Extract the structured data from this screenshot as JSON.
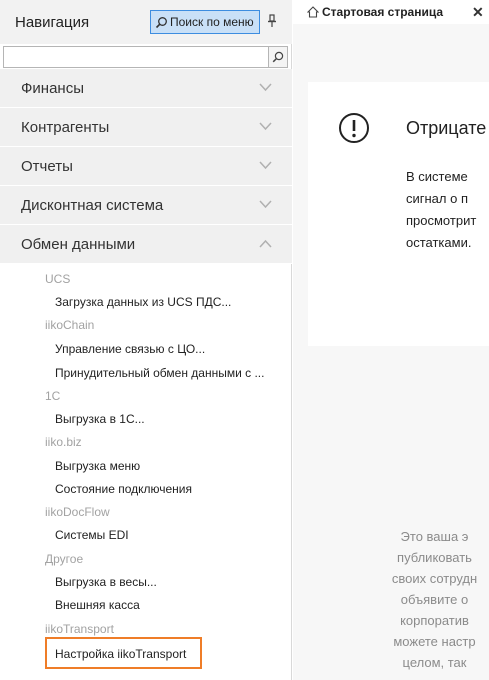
{
  "nav": {
    "title": "Навигация",
    "search_button_label": "Поиск по меню",
    "search_placeholder": "",
    "sections": [
      {
        "label": "Финансы",
        "expanded": false
      },
      {
        "label": "Контрагенты",
        "expanded": false
      },
      {
        "label": "Отчеты",
        "expanded": false
      },
      {
        "label": "Дисконтная система",
        "expanded": false
      },
      {
        "label": "Обмен данными",
        "expanded": true
      }
    ],
    "tree": {
      "g_ucs": "UCS",
      "i_ucs_load": "Загрузка данных из UCS ПДС...",
      "g_iikochain": "iikoChain",
      "i_chain_mgmt": "Управление связью с ЦО...",
      "i_chain_force": "Принудительный обмен данными с ...",
      "g_1c": "1С",
      "i_1c_export": "Выгрузка в 1С...",
      "g_iikobiz": "iiko.biz",
      "i_biz_menu": "Выгрузка меню",
      "i_biz_status": "Состояние подключения",
      "g_docflow": "iikoDocFlow",
      "i_edi": "Системы EDI",
      "g_other": "Другое",
      "i_scales": "Выгрузка в весы...",
      "i_cashbox": "Внешняя касса",
      "g_transport": "iikoTransport",
      "i_transport_settings": "Настройка iikoTransport"
    },
    "highlight_color": "#ef7d28"
  },
  "tab": {
    "label": "Стартовая страница",
    "close": "✕"
  },
  "card": {
    "title": "Отрицате",
    "lines": [
      "В системе",
      "сигнал о п",
      "просмотрит",
      "остатками."
    ]
  },
  "promo": {
    "lines": [
      "Это ваша э",
      "публиковать",
      "своих сотрудн",
      "объявите о",
      "корпоратив",
      "можете настр",
      "целом, так"
    ]
  },
  "colors": {
    "search_button_bg": "#c9e0f7",
    "search_button_border": "#3d8de0"
  }
}
